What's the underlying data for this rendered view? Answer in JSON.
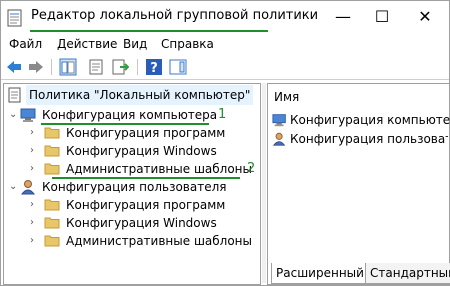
{
  "window": {
    "title": "Редактор локальной групповой политики",
    "controls": {
      "minimize": "—",
      "maximize": "☐",
      "close": "✕"
    }
  },
  "menu": [
    "Файл",
    "Действие",
    "Вид",
    "Справка"
  ],
  "toolbar": {
    "buttons": [
      "back-icon",
      "forward-icon",
      "show-hide-tree-icon",
      "properties-icon",
      "export-list-icon",
      "help-icon",
      "action-pane-icon"
    ]
  },
  "tree": {
    "root": "Политика \"Локальный компьютер\"",
    "computer": {
      "label": "Конфигурация компьютера",
      "marker": "1",
      "children": [
        "Конфигурация программ",
        "Конфигурация Windows",
        "Административные шаблоны"
      ],
      "admin_marker": "2"
    },
    "user": {
      "label": "Конфигурация пользователя",
      "children": [
        "Конфигурация программ",
        "Конфигурация Windows",
        "Административные шаблоны"
      ]
    }
  },
  "details": {
    "column": "Имя",
    "items": [
      "Конфигурация компьютера",
      "Конфигурация пользовате"
    ]
  },
  "tabs": [
    "Расширенный",
    "Стандартный"
  ],
  "colors": {
    "annotation": "#1e8f2e",
    "folder": "#e8c66a",
    "selection": "#e5f3ff"
  }
}
